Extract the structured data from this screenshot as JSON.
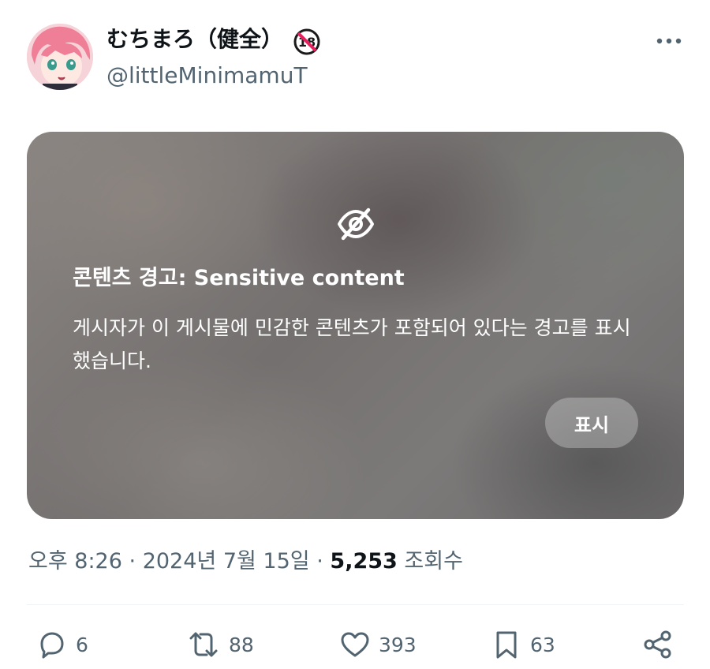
{
  "author": {
    "display_name": "むちまろ（健全）",
    "handle": "@littleMinimamuT",
    "badge": "18"
  },
  "sensitive": {
    "icon": "eye-slash-icon",
    "title": "콘텐츠 경고: Sensitive content",
    "body": "게시자가 이 게시물에 민감한 콘텐츠가 포함되어 있다는 경고를 표시했습니다.",
    "show_label": "표시"
  },
  "meta": {
    "time": "오후 8:26",
    "separator": "·",
    "date": "2024년 7월 15일",
    "views": "5,253",
    "views_label": "조회수"
  },
  "actions": {
    "reply_count": "6",
    "repost_count": "88",
    "like_count": "393",
    "bookmark_count": "63"
  },
  "colors": {
    "text_primary": "#0f1419",
    "text_secondary": "#536471",
    "badge_red": "#e0245e"
  }
}
